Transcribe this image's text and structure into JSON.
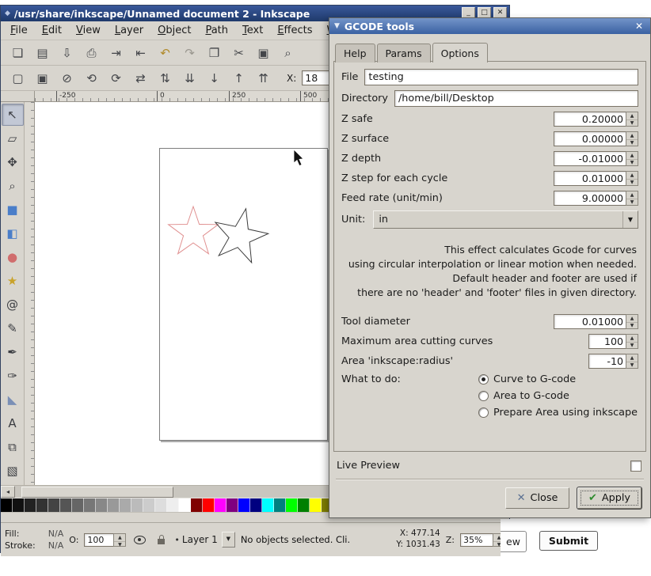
{
  "window": {
    "title": "/usr/share/inkscape/Unnamed document 2 - Inkscape",
    "controls": {
      "minimize": "_",
      "maximize": "□",
      "close": "✕"
    }
  },
  "icons": {
    "window_icon": "◆",
    "dock_arrow": "▼",
    "dialog_close": "✕",
    "combo_arrow": "▼",
    "dropdown_arrow": "▼",
    "scroll_left": "◂",
    "scroll_right": "▸",
    "layer_dot": "•",
    "button_close_x": "✕",
    "button_apply_check": "✔"
  },
  "menu": {
    "items": [
      "File",
      "Edit",
      "View",
      "Layer",
      "Object",
      "Path",
      "Text",
      "Effects",
      "Whiteboard"
    ]
  },
  "toolbar_main": {
    "items": [
      {
        "name": "new-document-button",
        "glyph": "❏"
      },
      {
        "name": "open-document-button",
        "glyph": "▤"
      },
      {
        "name": "save-document-button",
        "glyph": "⇩"
      },
      {
        "name": "print-button",
        "glyph": "⎙"
      },
      {
        "name": "import-button",
        "glyph": "⇥"
      },
      {
        "name": "export-button",
        "glyph": "⇤"
      },
      {
        "name": "undo-button",
        "glyph": "↶",
        "color": "#b08a2a"
      },
      {
        "name": "redo-button",
        "glyph": "↷",
        "color": "#9a978f"
      },
      {
        "name": "copy-button",
        "glyph": "❐"
      },
      {
        "name": "cut-button",
        "glyph": "✂"
      },
      {
        "name": "paste-button",
        "glyph": "▣"
      },
      {
        "name": "zoom-drawing-button",
        "glyph": "⌕"
      }
    ]
  },
  "toolbar_tool": {
    "items": [
      {
        "name": "select-all-button",
        "glyph": "▢"
      },
      {
        "name": "select-all-layers-button",
        "glyph": "▣"
      },
      {
        "name": "deselect-button",
        "glyph": "⊘"
      },
      {
        "name": "rotate-ccw-button",
        "glyph": "⟲"
      },
      {
        "name": "rotate-cw-button",
        "glyph": "⟳"
      },
      {
        "name": "flip-horizontal-button",
        "glyph": "⇄"
      },
      {
        "name": "flip-vertical-button",
        "glyph": "⇅"
      },
      {
        "name": "lower-to-bottom-button",
        "glyph": "⇊"
      },
      {
        "name": "lower-button",
        "glyph": "↓"
      },
      {
        "name": "raise-button",
        "glyph": "↑"
      },
      {
        "name": "raise-to-top-button",
        "glyph": "⇈"
      }
    ],
    "x_label": "X:",
    "x_value": "18"
  },
  "ruler": {
    "h_labels": [
      "-250",
      "0",
      "250",
      "500"
    ]
  },
  "toolbox": {
    "tools": [
      {
        "name": "selector-tool",
        "glyph": "↖",
        "active": true
      },
      {
        "name": "node-tool",
        "glyph": "▱"
      },
      {
        "name": "tweak-tool",
        "glyph": "✥"
      },
      {
        "name": "zoom-tool",
        "glyph": "⌕"
      },
      {
        "name": "rectangle-tool",
        "glyph": "■",
        "color": "#4a7ec9"
      },
      {
        "name": "3dbox-tool",
        "glyph": "◧",
        "color": "#4a7ec9"
      },
      {
        "name": "ellipse-tool",
        "glyph": "●",
        "color": "#d06d6d"
      },
      {
        "name": "star-tool",
        "glyph": "★",
        "color": "#c9a22a"
      },
      {
        "name": "spiral-tool",
        "glyph": "@"
      },
      {
        "name": "pencil-tool",
        "glyph": "✎"
      },
      {
        "name": "pen-tool",
        "glyph": "✒"
      },
      {
        "name": "calligraphy-tool",
        "glyph": "✑"
      },
      {
        "name": "paint-bucket-tool",
        "glyph": "◣",
        "color": "#7a8fb5"
      },
      {
        "name": "text-tool",
        "glyph": "A"
      },
      {
        "name": "connector-tool",
        "glyph": "⧉"
      },
      {
        "name": "gradient-tool",
        "glyph": "▧"
      },
      {
        "name": "dropper-tool",
        "glyph": "∖"
      }
    ]
  },
  "palette": {
    "colors": [
      "#000000",
      "#111111",
      "#222222",
      "#333333",
      "#444444",
      "#555555",
      "#666666",
      "#777777",
      "#888888",
      "#999999",
      "#aaaaaa",
      "#bbbbbb",
      "#cccccc",
      "#dddddd",
      "#eeeeee",
      "#ffffff",
      "#800000",
      "#ff0000",
      "#ff00ff",
      "#800080",
      "#0000ff",
      "#000080",
      "#00ffff",
      "#008080",
      "#00ff00",
      "#008000",
      "#ffff00",
      "#808000"
    ]
  },
  "status": {
    "fill_label": "Fill:",
    "fill_value": "N/A",
    "stroke_label": "Stroke:",
    "stroke_value": "N/A",
    "opacity_label": "O:",
    "opacity_value": "100",
    "layer_label": "Layer 1",
    "message": "No objects selected. Cli.",
    "x_label": "X:",
    "x_value": "477.14",
    "y_label": "Y:",
    "y_value": "1031.43",
    "zoom_label": "Z:",
    "zoom_value": "35%"
  },
  "dialog": {
    "title": "GCODE tools",
    "tabs": [
      "Help",
      "Params",
      "Options"
    ],
    "active_tab": "Options",
    "file": {
      "label": "File",
      "value": "testing"
    },
    "directory": {
      "label": "Directory",
      "value": "/home/bill/Desktop"
    },
    "fields": [
      {
        "label": "Z safe",
        "value": "0.20000"
      },
      {
        "label": "Z surface",
        "value": "0.00000"
      },
      {
        "label": "Z depth",
        "value": "-0.01000"
      },
      {
        "label": "Z step for each cycle",
        "value": "0.01000"
      },
      {
        "label": "Feed rate (unit/min)",
        "value": "9.00000"
      }
    ],
    "unit": {
      "label": "Unit:",
      "value": "in"
    },
    "description": [
      "This effect calculates Gcode for curves",
      "using circular interpolation or linear motion when needed.",
      "Default header and footer are used if",
      "there are no 'header' and 'footer' files in given directory."
    ],
    "params": [
      {
        "label": "Tool diameter",
        "value": "0.01000"
      },
      {
        "label": "Maximum area cutting curves",
        "value": "100"
      },
      {
        "label": "Area 'inkscape:radius'",
        "value": "-10"
      }
    ],
    "what_to_do": {
      "label": "What to do:",
      "options": [
        {
          "label": "Curve to G-code",
          "selected": true
        },
        {
          "label": "Area to G-code",
          "selected": false
        },
        {
          "label": "Prepare Area using inkscape",
          "selected": false
        }
      ]
    },
    "live_preview": "Live Preview",
    "buttons": {
      "close": "Close",
      "apply": "Apply"
    }
  },
  "external": {
    "partial_label": "ew",
    "submit_label": "Submit"
  }
}
